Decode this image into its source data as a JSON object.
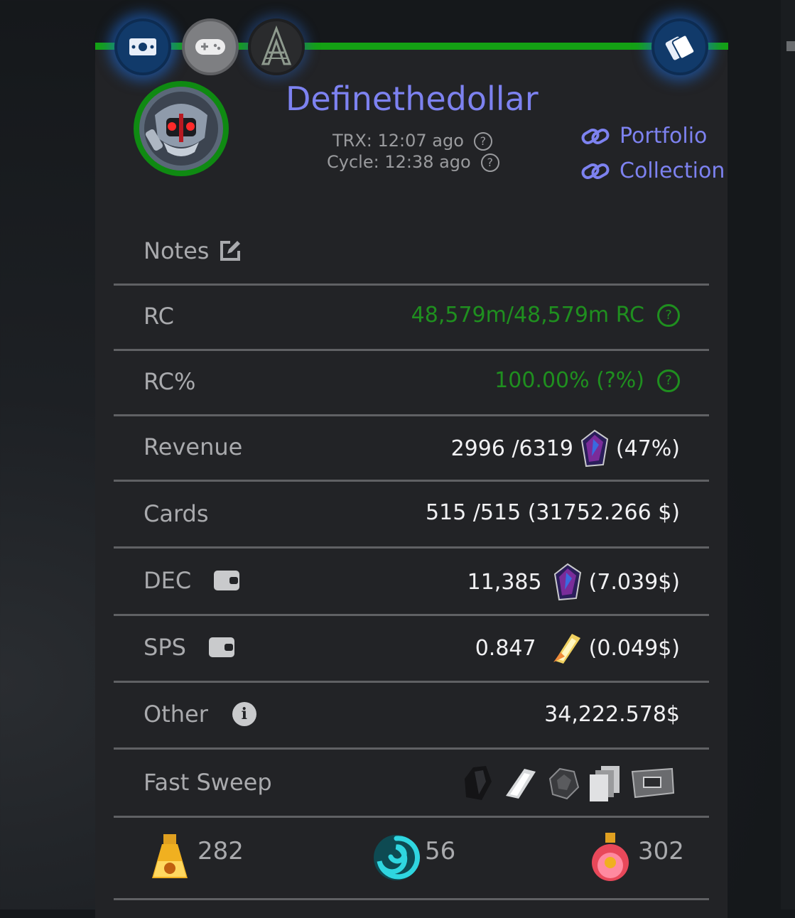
{
  "header": {
    "buttons": [
      "cash-icon",
      "gamepad-icon",
      "logo-a-icon",
      "cards-icon"
    ],
    "colors": {
      "accent_bar": "#14a114",
      "link": "#7d82f0",
      "value_green": "#1f8f1f"
    }
  },
  "profile": {
    "username": "Definethedollar",
    "trx_label": "TRX: 12:07 ago",
    "cycle_label": "Cycle: 12:38 ago",
    "links": [
      {
        "label": "Portfolio"
      },
      {
        "label": "Collection"
      }
    ]
  },
  "rows": {
    "notes": {
      "label": "Notes"
    },
    "rc": {
      "label": "RC",
      "value": "48,579m/48,579m RC"
    },
    "rc_pct": {
      "label": "RC%",
      "value": "100.00% (?%)"
    },
    "revenue": {
      "label": "Revenue",
      "value": "2996 /6319",
      "pct": "(47%)"
    },
    "cards": {
      "label": "Cards",
      "value": "515 /515 (31752.266 $)"
    },
    "dec": {
      "label": "DEC",
      "value": "11,385",
      "usd": "(7.039$)"
    },
    "sps": {
      "label": "SPS",
      "value": "0.847",
      "usd": "(0.049$)"
    },
    "other": {
      "label": "Other",
      "value": "34,222.578$"
    },
    "fast_sweep": {
      "label": "Fast Sweep",
      "icons": [
        "dark-shard-icon",
        "crystal-shard-icon",
        "rock-icon",
        "cards-stack-icon",
        "plaque-icon"
      ]
    }
  },
  "potions": [
    {
      "icon": "gold-potion-icon",
      "value": "282"
    },
    {
      "icon": "swirl-icon",
      "value": "56"
    },
    {
      "icon": "legendary-potion-icon",
      "value": "302"
    }
  ]
}
